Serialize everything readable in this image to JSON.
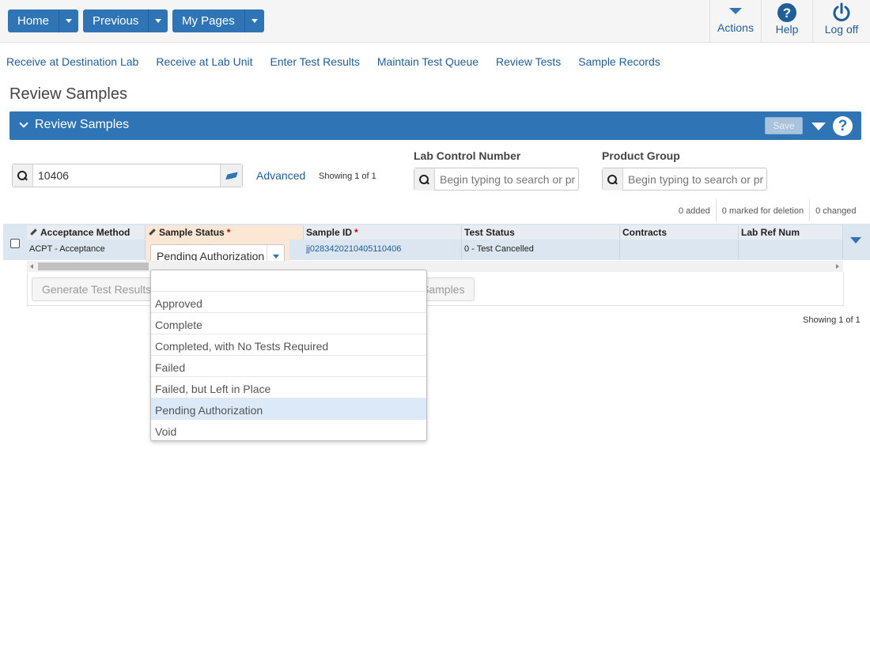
{
  "topnav": {
    "home": "Home",
    "previous": "Previous",
    "my_pages": "My Pages"
  },
  "rightmenu": {
    "actions": "Actions",
    "help": "Help",
    "logoff": "Log off"
  },
  "links": [
    "Receive at Destination Lab",
    "Receive at Lab Unit",
    "Enter Test Results",
    "Maintain Test Queue",
    "Review Tests",
    "Sample Records"
  ],
  "page_title": "Review Samples",
  "panel": {
    "title": "Review Samples",
    "save_label": "Save",
    "help_glyph": "?"
  },
  "search": {
    "value": "10406",
    "advanced": "Advanced",
    "showing": "Showing 1 of 1"
  },
  "lab_control": {
    "label": "Lab Control Number",
    "placeholder": "Begin typing to search or press"
  },
  "product_group": {
    "label": "Product Group",
    "placeholder": "Begin typing to search or press"
  },
  "counts": {
    "added": "0 added",
    "deletion": "0 marked for deletion",
    "changed": "0 changed"
  },
  "grid": {
    "columns": [
      "Acceptance Method",
      "Sample Status",
      "Sample ID",
      "Test Status",
      "Contracts",
      "Lab Ref Num"
    ],
    "row": {
      "acceptance": "ACPT - Acceptance",
      "status": "Pending Authorization",
      "sample_id": "jj0283420210405110406",
      "test_status": "0 - Test Cancelled",
      "contracts": "",
      "lab_ref": ""
    }
  },
  "buttons": {
    "generate": "Generate Test Results",
    "samples": "Samples"
  },
  "showing_bottom": "Showing 1 of 1",
  "status_options": [
    "Approved",
    "Complete",
    "Completed, with No Tests Required",
    "Failed",
    "Failed, but Left in Place",
    "Pending Authorization",
    "Void"
  ],
  "selected_option": "Pending Authorization",
  "colors": {
    "primary": "#2f74b5",
    "link": "#1f5e96",
    "status_col": "#fce6d4",
    "selected_row": "#dbe9f8"
  }
}
